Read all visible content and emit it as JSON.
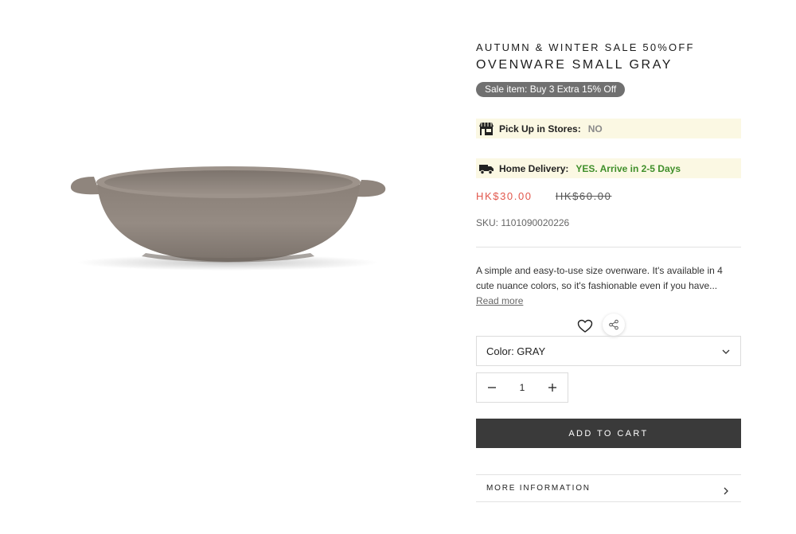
{
  "product": {
    "sale_title": "AUTUMN & WINTER SALE 50%OFF",
    "name": "OVENWARE SMALL GRAY",
    "sale_badge": "Sale item: Buy 3 Extra 15% Off",
    "image_icon": "gray-oven-dish-image"
  },
  "availability": {
    "pickup_label": "Pick Up in Stores:",
    "pickup_value": "NO",
    "pickup_icon": "store-icon",
    "delivery_label": "Home Delivery:",
    "delivery_value": "YES. Arrive in 2-5 Days",
    "delivery_icon": "truck-icon"
  },
  "pricing": {
    "sale_price": "HK$30.00",
    "original_price": "HK$60.00",
    "sku": "SKU: 1101090020226"
  },
  "description": {
    "text": "A simple and easy-to-use size ovenware. It's available in 4 cute nuance colors, so it's fashionable even if you have...",
    "read_more": "Read more"
  },
  "options": {
    "color_select": "Color: GRAY",
    "quantity": "1"
  },
  "actions": {
    "add_to_cart": "ADD TO CART",
    "more_information": "MORE INFORMATION"
  },
  "colors": {
    "accent_sale": "#e2574c",
    "delivery_yes": "#3f8f2a",
    "badge_bg": "#707070",
    "cart_bg": "#3a3a3a",
    "highlight_bg": "#fbf8e3"
  }
}
